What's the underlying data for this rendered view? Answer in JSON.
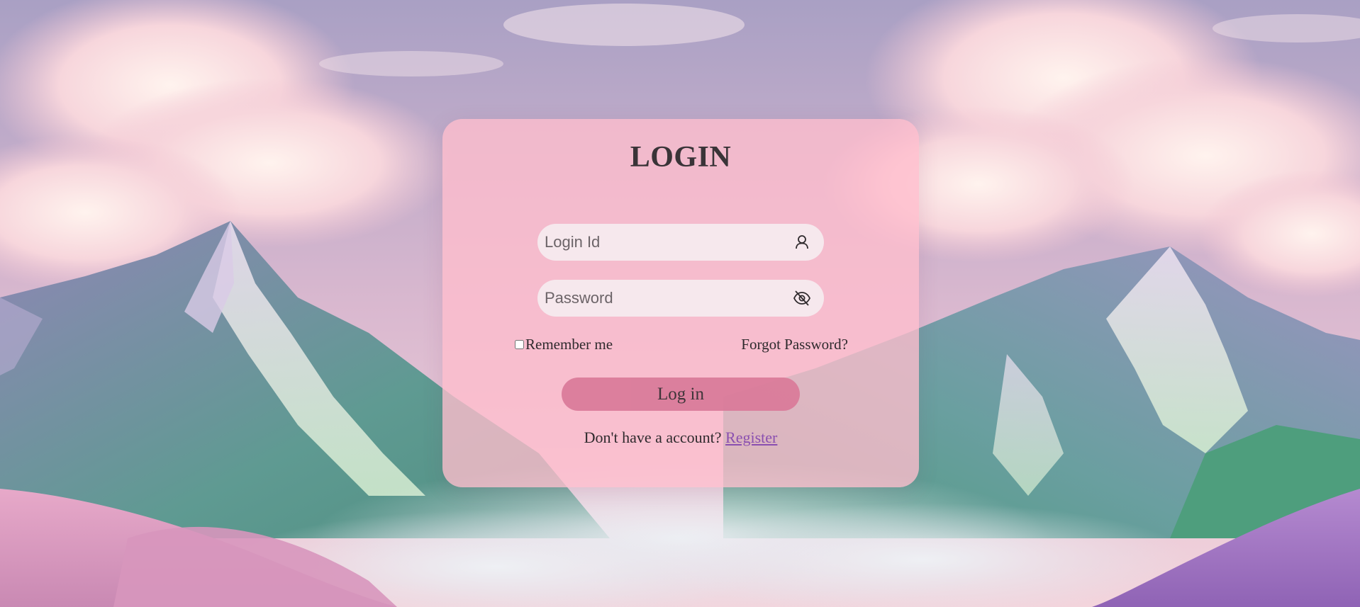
{
  "login": {
    "title": "LOGIN",
    "login_id_placeholder": "Login Id",
    "password_placeholder": "Password",
    "remember_label": "Remember me",
    "forgot_label": "Forgot Password?",
    "submit_label": "Log in",
    "register_prompt": "Don't have a account?",
    "register_link": "Register"
  },
  "icons": {
    "login_id": "user-icon",
    "password": "eye-slash-icon"
  },
  "colors": {
    "card_bg": "#ffbecd",
    "button_bg": "#d97a99",
    "link": "#8a4fb0",
    "text": "#2f2a2d"
  }
}
